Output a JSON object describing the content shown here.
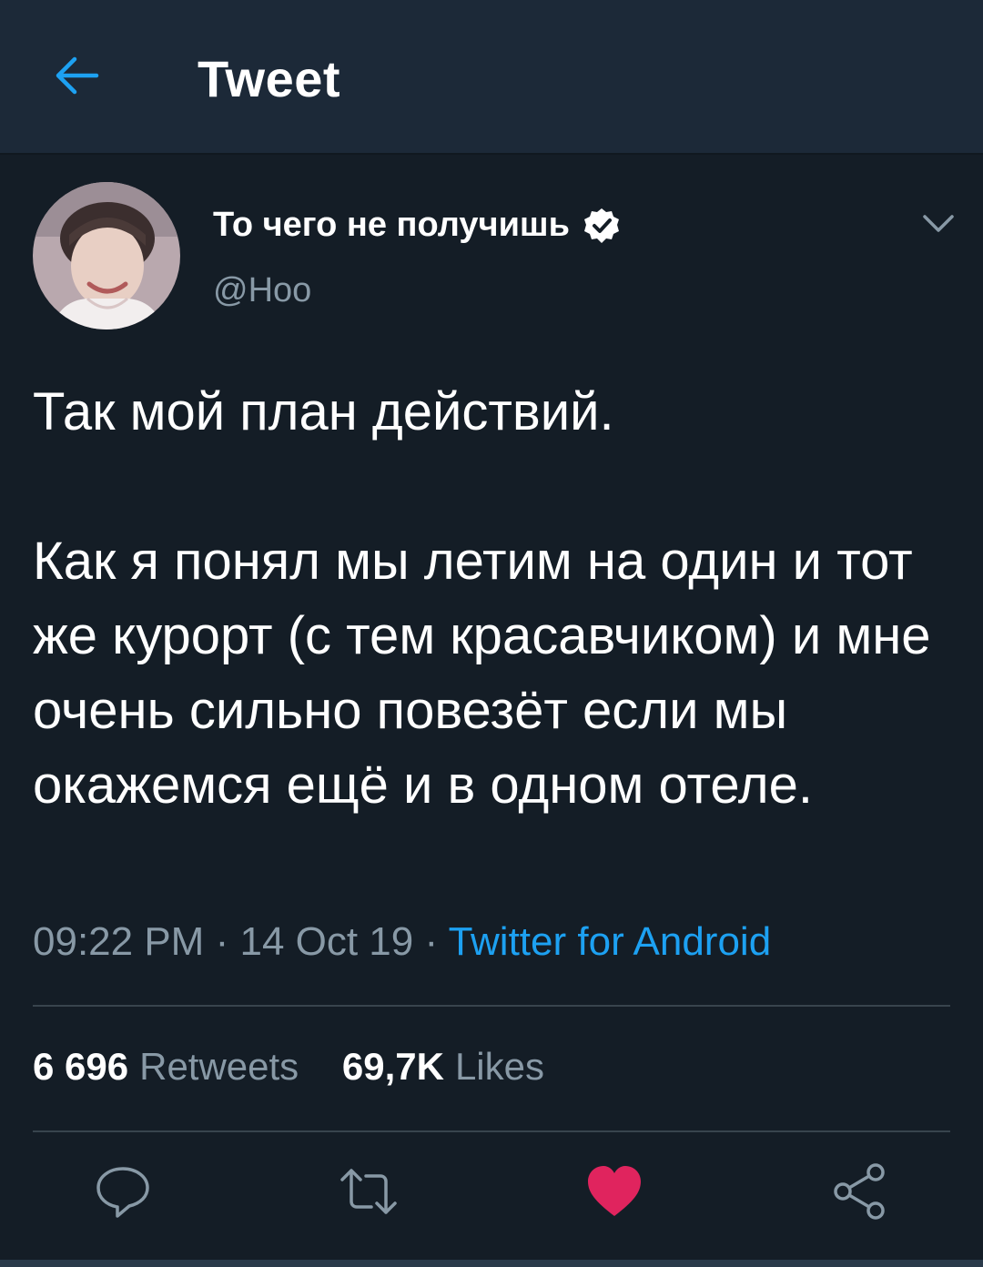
{
  "header": {
    "title": "Tweet",
    "back_icon": "arrow-left-icon"
  },
  "author": {
    "display_name": "То чего не получишь",
    "handle": "@Hoo",
    "verified": true,
    "menu_icon": "chevron-down-icon"
  },
  "tweet": {
    "paragraphs": [
      "Так мой план действий.",
      "Как я понял мы летим на один и тот же курорт (с тем красавчиком) и мне очень сильно повезёт если мы окажемся ещё и в одном отеле."
    ],
    "time": "09:22 PM",
    "date": "14 Oct 19",
    "separator": "·",
    "source": "Twitter for Android"
  },
  "stats": {
    "retweets_count": "6 696",
    "retweets_label": "Retweets",
    "likes_count": "69,7K",
    "likes_label": "Likes"
  },
  "actions": [
    {
      "name": "reply",
      "icon": "reply-icon"
    },
    {
      "name": "retweet",
      "icon": "retweet-icon"
    },
    {
      "name": "like",
      "icon": "heart-icon",
      "active": true
    },
    {
      "name": "share",
      "icon": "share-icon"
    }
  ],
  "colors": {
    "background": "#141d26",
    "header_background": "#1c2938",
    "accent": "#1da1f2",
    "secondary_text": "#8899a6",
    "like_active": "#e0245e",
    "divider": "#38444d"
  }
}
